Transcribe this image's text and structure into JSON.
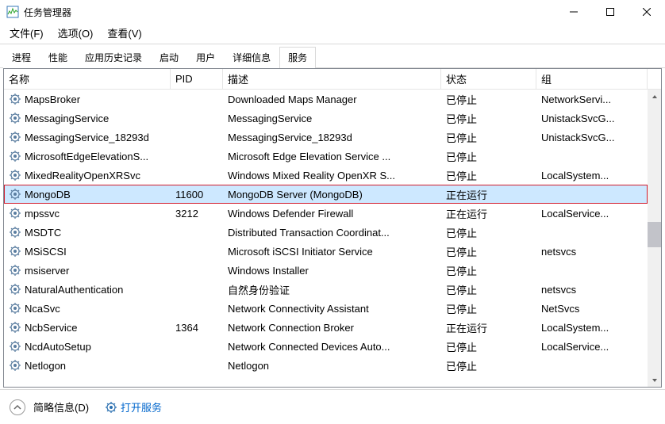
{
  "window": {
    "title": "任务管理器"
  },
  "menu": {
    "file": "文件(F)",
    "options": "选项(O)",
    "view": "查看(V)"
  },
  "tabs": {
    "processes": "进程",
    "performance": "性能",
    "apphistory": "应用历史记录",
    "startup": "启动",
    "users": "用户",
    "details": "详细信息",
    "services": "服务"
  },
  "columns": {
    "name": "名称",
    "pid": "PID",
    "desc": "描述",
    "status": "状态",
    "group": "组"
  },
  "rows": [
    {
      "name": "MapsBroker",
      "pid": "",
      "desc": "Downloaded Maps Manager",
      "status": "已停止",
      "group": "NetworkServi..."
    },
    {
      "name": "MessagingService",
      "pid": "",
      "desc": "MessagingService",
      "status": "已停止",
      "group": "UnistackSvcG..."
    },
    {
      "name": "MessagingService_18293d",
      "pid": "",
      "desc": "MessagingService_18293d",
      "status": "已停止",
      "group": "UnistackSvcG..."
    },
    {
      "name": "MicrosoftEdgeElevationS...",
      "pid": "",
      "desc": "Microsoft Edge Elevation Service ...",
      "status": "已停止",
      "group": ""
    },
    {
      "name": "MixedRealityOpenXRSvc",
      "pid": "",
      "desc": "Windows Mixed Reality OpenXR S...",
      "status": "已停止",
      "group": "LocalSystem..."
    },
    {
      "name": "MongoDB",
      "pid": "11600",
      "desc": "MongoDB Server (MongoDB)",
      "status": "正在运行",
      "group": "",
      "selected": true
    },
    {
      "name": "mpssvc",
      "pid": "3212",
      "desc": "Windows Defender Firewall",
      "status": "正在运行",
      "group": "LocalService..."
    },
    {
      "name": "MSDTC",
      "pid": "",
      "desc": "Distributed Transaction Coordinat...",
      "status": "已停止",
      "group": ""
    },
    {
      "name": "MSiSCSI",
      "pid": "",
      "desc": "Microsoft iSCSI Initiator Service",
      "status": "已停止",
      "group": "netsvcs"
    },
    {
      "name": "msiserver",
      "pid": "",
      "desc": "Windows Installer",
      "status": "已停止",
      "group": ""
    },
    {
      "name": "NaturalAuthentication",
      "pid": "",
      "desc": "自然身份验证",
      "status": "已停止",
      "group": "netsvcs"
    },
    {
      "name": "NcaSvc",
      "pid": "",
      "desc": "Network Connectivity Assistant",
      "status": "已停止",
      "group": "NetSvcs"
    },
    {
      "name": "NcbService",
      "pid": "1364",
      "desc": "Network Connection Broker",
      "status": "正在运行",
      "group": "LocalSystem..."
    },
    {
      "name": "NcdAutoSetup",
      "pid": "",
      "desc": "Network Connected Devices Auto...",
      "status": "已停止",
      "group": "LocalService..."
    },
    {
      "name": "Netlogon",
      "pid": "",
      "desc": "Netlogon",
      "status": "已停止",
      "group": ""
    }
  ],
  "footer": {
    "fewer": "简略信息(D)",
    "open_services": "打开服务"
  }
}
